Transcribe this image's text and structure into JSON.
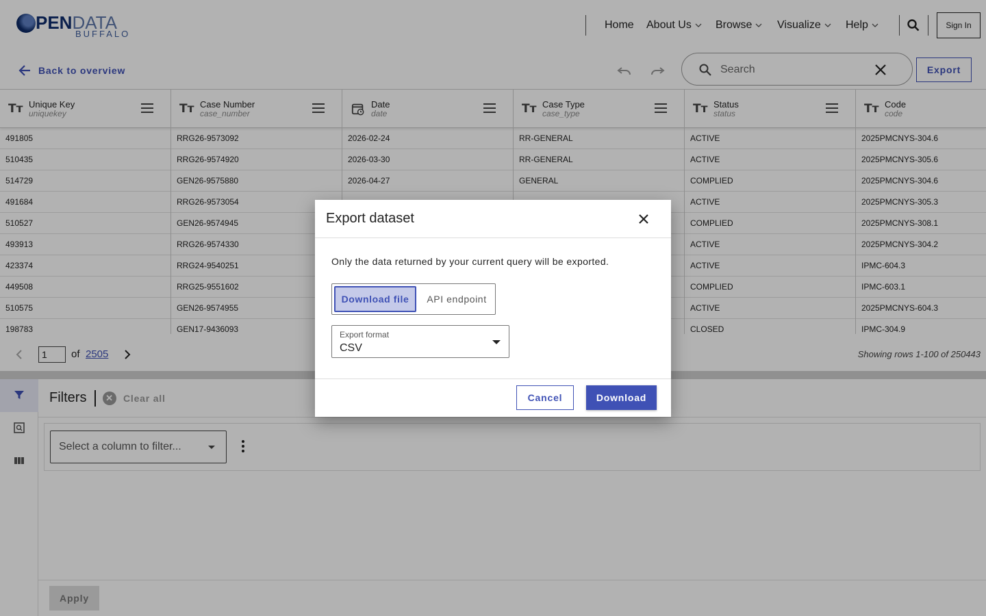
{
  "header": {
    "logo": {
      "word_dark": "PEN",
      "word_light": "DATA",
      "sub": "BUFFALO"
    },
    "nav": [
      "Home",
      "About Us",
      "Browse",
      "Visualize",
      "Help"
    ],
    "sign_in": "Sign In"
  },
  "toolbar": {
    "back_label": "Back to overview",
    "search_placeholder": "Search",
    "export_label": "Export"
  },
  "table": {
    "columns": [
      {
        "name": "Unique Key",
        "field": "uniquekey",
        "icon": "text-type-icon"
      },
      {
        "name": "Case Number",
        "field": "case_number",
        "icon": "text-type-icon"
      },
      {
        "name": "Date",
        "field": "date",
        "icon": "calendar-icon"
      },
      {
        "name": "Case Type",
        "field": "case_type",
        "icon": "text-type-icon"
      },
      {
        "name": "Status",
        "field": "status",
        "icon": "text-type-icon"
      },
      {
        "name": "Code",
        "field": "code",
        "icon": "text-type-icon"
      }
    ],
    "rows": [
      [
        "491805",
        "RRG26-9573092",
        "2026-02-24",
        "RR-GENERAL",
        "ACTIVE",
        "2025PMCNYS-304.6"
      ],
      [
        "510435",
        "RRG26-9574920",
        "2026-03-30",
        "RR-GENERAL",
        "ACTIVE",
        "2025PMCNYS-305.6"
      ],
      [
        "514729",
        "GEN26-9575880",
        "2026-04-27",
        "GENERAL",
        "COMPLIED",
        "2025PMCNYS-304.6"
      ],
      [
        "491684",
        "RRG26-9573054",
        "",
        "",
        "ACTIVE",
        "2025PMCNYS-305.3"
      ],
      [
        "510527",
        "GEN26-9574945",
        "",
        "",
        "COMPLIED",
        "2025PMCNYS-308.1"
      ],
      [
        "493913",
        "RRG26-9574330",
        "",
        "",
        "ACTIVE",
        "2025PMCNYS-304.2"
      ],
      [
        "423374",
        "RRG24-9540251",
        "",
        "",
        "ACTIVE",
        "IPMC-604.3"
      ],
      [
        "449508",
        "RRG25-9551602",
        "",
        "",
        "COMPLIED",
        "IPMC-603.1"
      ],
      [
        "510575",
        "GEN26-9574955",
        "",
        "",
        "ACTIVE",
        "2025PMCNYS-604.3"
      ],
      [
        "198783",
        "GEN17-9436093",
        "",
        "",
        "CLOSED",
        "IPMC-304.9"
      ]
    ]
  },
  "pager": {
    "page": "1",
    "of": "of",
    "total_pages": "2505",
    "status": "Showing rows 1-100 of 250443"
  },
  "filters": {
    "title": "Filters",
    "clear_all": "Clear all",
    "select_placeholder": "Select a column to filter...",
    "apply": "Apply"
  },
  "modal": {
    "title": "Export dataset",
    "description": "Only the data returned by your current query will be exported.",
    "tab_file": "Download file",
    "tab_api": "API endpoint",
    "format_label": "Export format",
    "format_value": "CSV",
    "cancel": "Cancel",
    "download": "Download"
  },
  "colors": {
    "accent": "#3f51b5",
    "accent_light": "#c5cae9"
  }
}
